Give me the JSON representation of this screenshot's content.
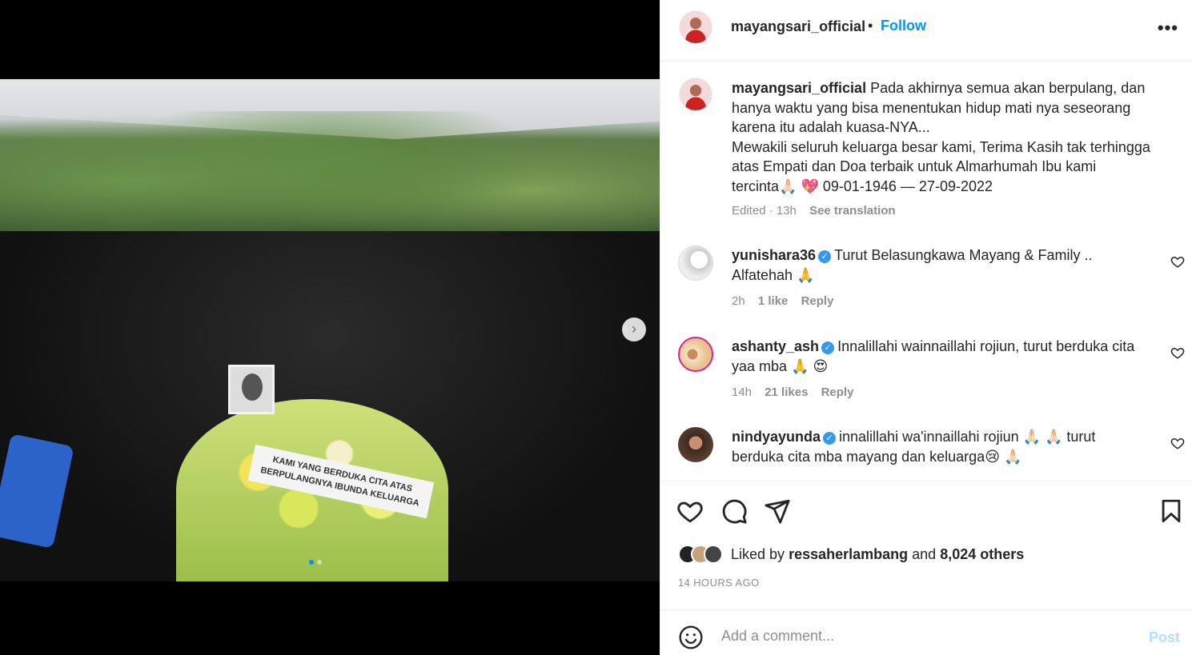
{
  "post": {
    "username": "mayangsari_official",
    "separator": "•",
    "follow_label": "Follow",
    "more_label": "•••",
    "caption_lines": [
      "Pada akhirnya semua akan berpulang, dan",
      "hanya waktu yang bisa menentukan hidup mati nya seseorang",
      "karena itu adalah kuasa-NYA...",
      "Mewakili seluruh keluarga besar kami, Terima Kasih tak terhingga",
      "atas Empati dan Doa terbaik untuk Almarhumah Ibu kami",
      "tercinta🙏🏻 💖 09-01-1946 — 27-09-2022"
    ],
    "caption_meta": "Edited · 13h",
    "see_translation": "See translation",
    "banner_text": "KAMI YANG BERDUKA CITA ATAS BERPULANGNYA IBUNDA KELUARGA"
  },
  "comments": [
    {
      "username": "yunishara36",
      "text_line1": "Turut Belasungkawa Mayang & Family ..",
      "text_line2": "Alfatehah 🙏",
      "time": "2h",
      "likes": "1 like",
      "reply": "Reply"
    },
    {
      "username": "ashanty_ash",
      "text_line1": "Innalillahi wainnaillahi rojiun, turut berduka cita",
      "text_line2": "yaa mba 🙏 😍",
      "time": "14h",
      "likes": "21 likes",
      "reply": "Reply"
    },
    {
      "username": "nindyayunda",
      "text_line1": "innalillahi wa'innaillahi rojiun 🙏🏻 🙏🏻 turut",
      "text_line2": "berduka cita mba mayang dan keluarga😢 🙏🏻",
      "time": "",
      "likes": "",
      "reply": ""
    }
  ],
  "likes_bar": {
    "prefix": "Liked by",
    "liker": "ressaherlambang",
    "middle": "and",
    "others": "8,024 others"
  },
  "timestamp": "14 HOURS AGO",
  "add_comment": {
    "placeholder": "Add a comment...",
    "post_label": "Post"
  },
  "colors": {
    "accent": "#0095f6",
    "verified": "#3897f0",
    "muted": "#8e8e8e",
    "post_disabled": "#b2dffc"
  },
  "carousel": {
    "next_icon": "›"
  }
}
